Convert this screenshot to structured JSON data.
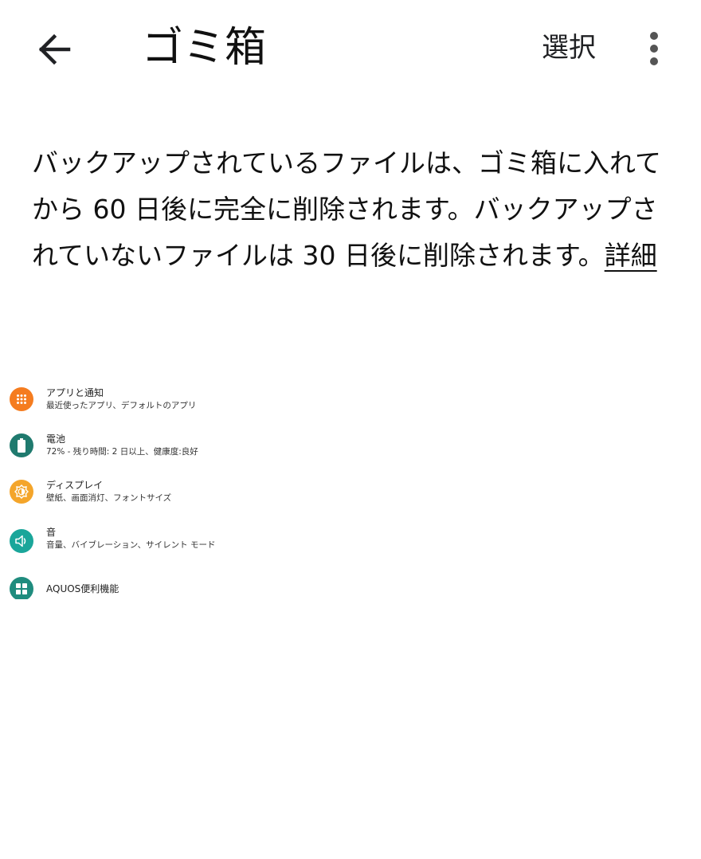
{
  "app_bar": {
    "title": "ゴミ箱",
    "select_label": "選択",
    "back_icon": "arrow-left-icon",
    "more_icon": "more-vert-icon"
  },
  "info": {
    "text": "バックアップされているファイルは、ゴミ箱に入れてから 60 日後に完全に削除されます。バックアップされていないファイルは 30 日後に削除されます。",
    "link_label": "詳細"
  },
  "settings": {
    "items": [
      {
        "title": "アプリと通知",
        "summary": "最近使ったアプリ、デフォルトのアプリ",
        "icon": "apps-grid-icon",
        "color": "#F57C1F"
      },
      {
        "title": "電池",
        "summary": "72% - 残り時間: 2 日以上、健康度:良好",
        "icon": "battery-icon",
        "color": "#1F7A6E"
      },
      {
        "title": "ディスプレイ",
        "summary": "壁紙、画面消灯、フォントサイズ",
        "icon": "brightness-icon",
        "color": "#F4A52A"
      },
      {
        "title": "音",
        "summary": "音量、バイブレーション、サイレント モード",
        "icon": "volume-icon",
        "color": "#1AA69A"
      },
      {
        "title": "AQUOS便利機能",
        "summary": "",
        "icon": "widgets-icon",
        "color": "#1F8C7E"
      }
    ]
  }
}
